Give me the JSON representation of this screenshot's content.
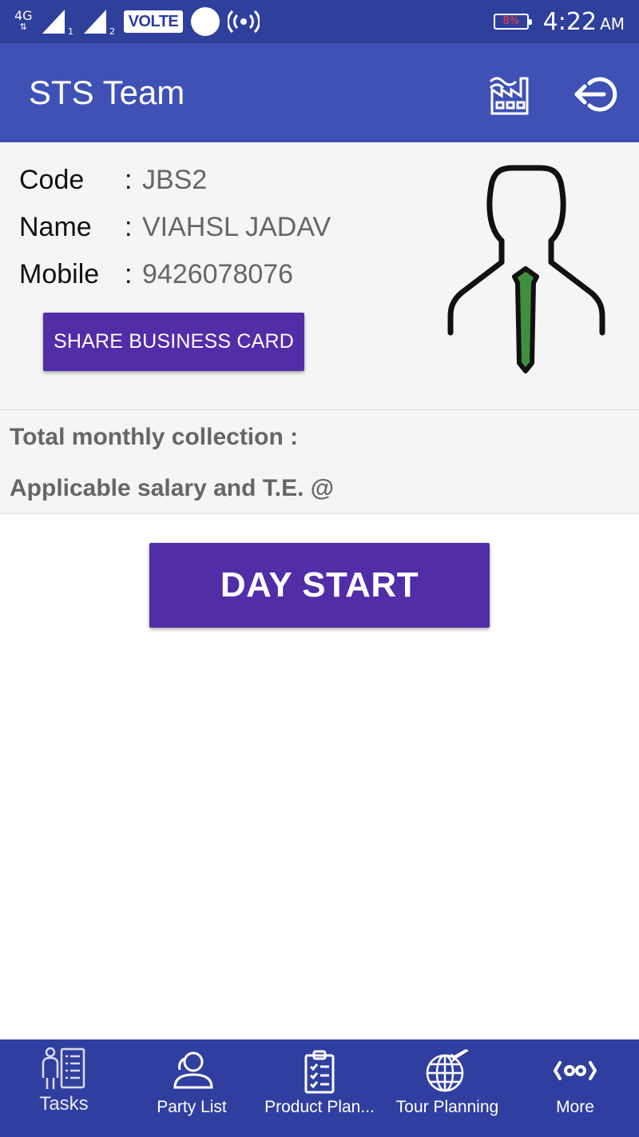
{
  "status_bar": {
    "network_type": "4G",
    "sim1": "1",
    "sim2": "2",
    "volte": "VOLTE",
    "battery": "8%",
    "time": "4:22",
    "ampm": "AM"
  },
  "app_bar": {
    "title": "STS Team",
    "icons": [
      "factory-icon",
      "logout-icon"
    ]
  },
  "profile": {
    "code_label": "Code",
    "code_value": "JBS2",
    "name_label": "Name",
    "name_value": "VIAHSL JADAV",
    "mobile_label": "Mobile",
    "mobile_value": "9426078076",
    "separator": ":",
    "share_button": "SHARE BUSINESS CARD"
  },
  "summary": {
    "collection_label": "Total monthly collection :",
    "salary_label": "Applicable salary and T.E. @"
  },
  "day_start_button": "DAY START",
  "bottom_nav": {
    "items": [
      {
        "label": "Tasks",
        "icon": "tasks-icon"
      },
      {
        "label": "Party List",
        "icon": "party-icon"
      },
      {
        "label": "Product Plan...",
        "icon": "clipboard-icon"
      },
      {
        "label": "Tour Planning",
        "icon": "globe-plane-icon"
      },
      {
        "label": "More",
        "icon": "more-icon"
      }
    ]
  },
  "colors": {
    "status_bar": "#2f3f9c",
    "app_bar": "#3f51b5",
    "primary_button": "#512da8",
    "bottom_nav": "#303f9f",
    "tie": "#3f8f3f"
  }
}
